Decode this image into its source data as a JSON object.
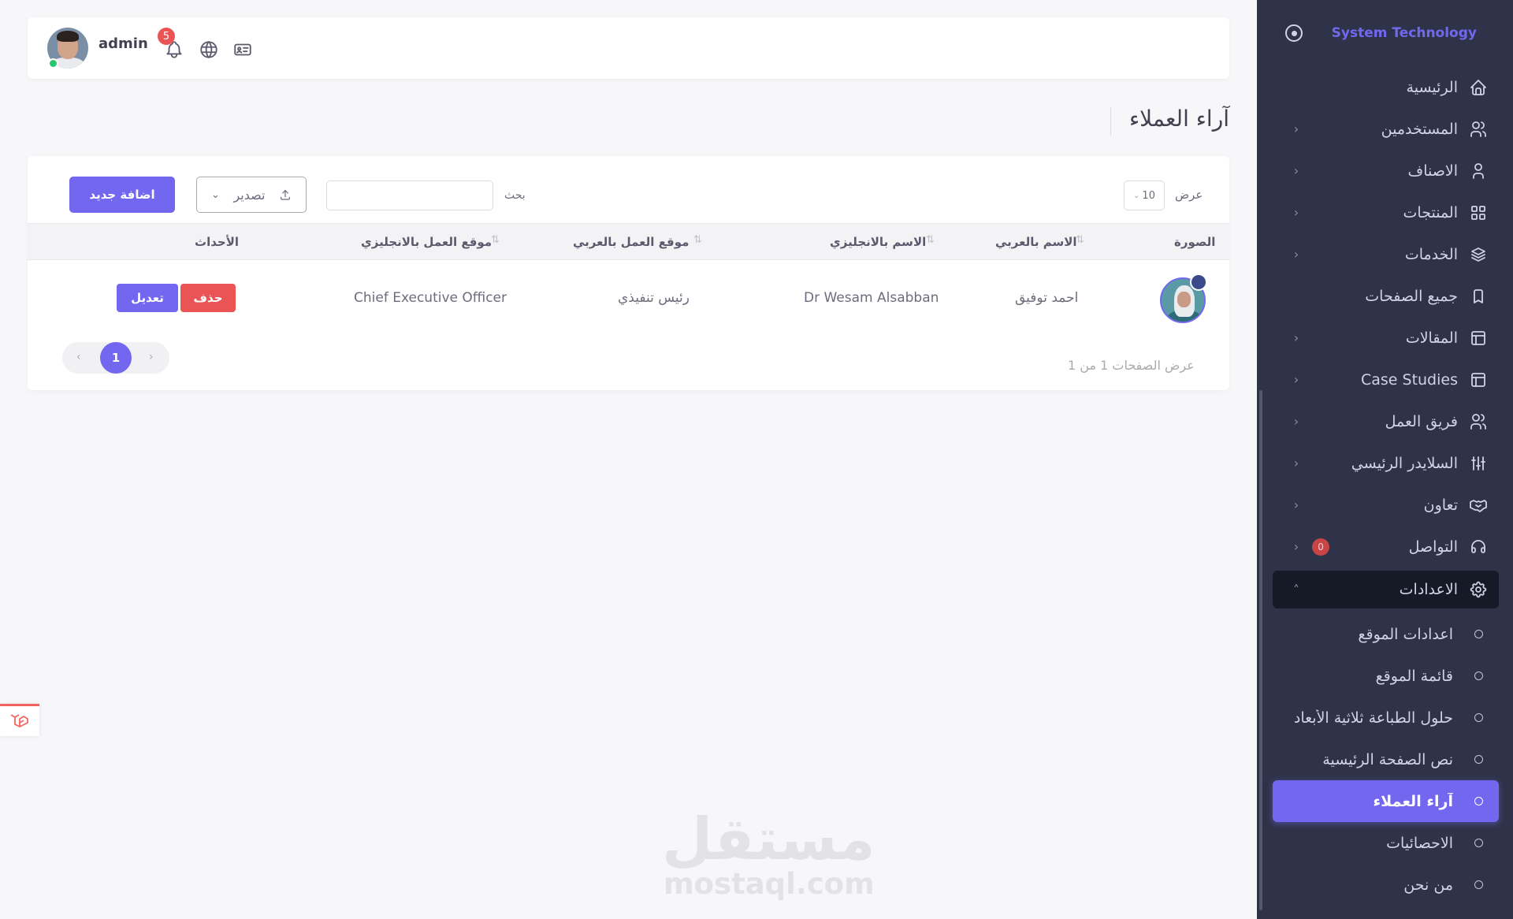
{
  "brand": {
    "name": "System Technology"
  },
  "navbar": {
    "username": "admin",
    "notifications_count": "5"
  },
  "page": {
    "title": "آراء العملاء"
  },
  "sidebar": {
    "items": [
      {
        "label": "الرئيسية",
        "icon": "home-icon"
      },
      {
        "label": "المستخدمين",
        "icon": "users-icon"
      },
      {
        "label": "الاصناف",
        "icon": "user-icon"
      },
      {
        "label": "المنتجات",
        "icon": "grid-icon"
      },
      {
        "label": "الخدمات",
        "icon": "layers-icon"
      },
      {
        "label": "جميع الصفحات",
        "icon": "bookmark-icon"
      },
      {
        "label": "المقالات",
        "icon": "layout-icon"
      },
      {
        "label": "Case Studies",
        "icon": "layout-icon"
      },
      {
        "label": "فريق العمل",
        "icon": "users-icon"
      },
      {
        "label": "السلايدر الرئيسي",
        "icon": "sliders-icon"
      },
      {
        "label": "تعاون",
        "icon": "handshake-icon"
      },
      {
        "label": "التواصل",
        "icon": "headphones-icon",
        "badge": "0"
      },
      {
        "label": "الاعدادات",
        "icon": "settings-icon"
      }
    ],
    "sub_items": [
      {
        "label": "اعدادات الموقع"
      },
      {
        "label": "قائمة الموقع"
      },
      {
        "label": "حلول الطباعة ثلاثية الأبعاد"
      },
      {
        "label": "نص الصفحة الرئيسية"
      },
      {
        "label": "آراء العملاء"
      },
      {
        "label": "الاحصائيات"
      },
      {
        "label": "من نحن"
      }
    ]
  },
  "toolbar": {
    "add_label": "اضافة جديد",
    "export_label": "تصدير",
    "search_label": "بحث",
    "search_value": "",
    "show_label": "عرض",
    "page_length": "10"
  },
  "table": {
    "headers": {
      "image": "الصورة",
      "name_ar": "الاسم بالعربي",
      "name_en": "الاسم بالانجليزي",
      "job_ar": "موقع العمل بالعربي",
      "job_en": "موقع العمل بالانجليزي",
      "actions": "الأحداث"
    },
    "rows": [
      {
        "name_ar": "احمد توفيق",
        "name_en": "Dr Wesam Alsabban",
        "job_ar": "رئيس تنفيذي",
        "job_en": "Chief Executive Officer",
        "edit_label": "تعديل",
        "delete_label": "حذف"
      }
    ]
  },
  "pagination": {
    "current": "1",
    "info": "عرض الصفحات 1 من 1"
  },
  "colors": {
    "primary": "#7367f0",
    "danger": "#ea5455",
    "sidebar": "#2f3349"
  },
  "watermark": {
    "arabic": "مستقل",
    "latin": "mostaql.com"
  }
}
